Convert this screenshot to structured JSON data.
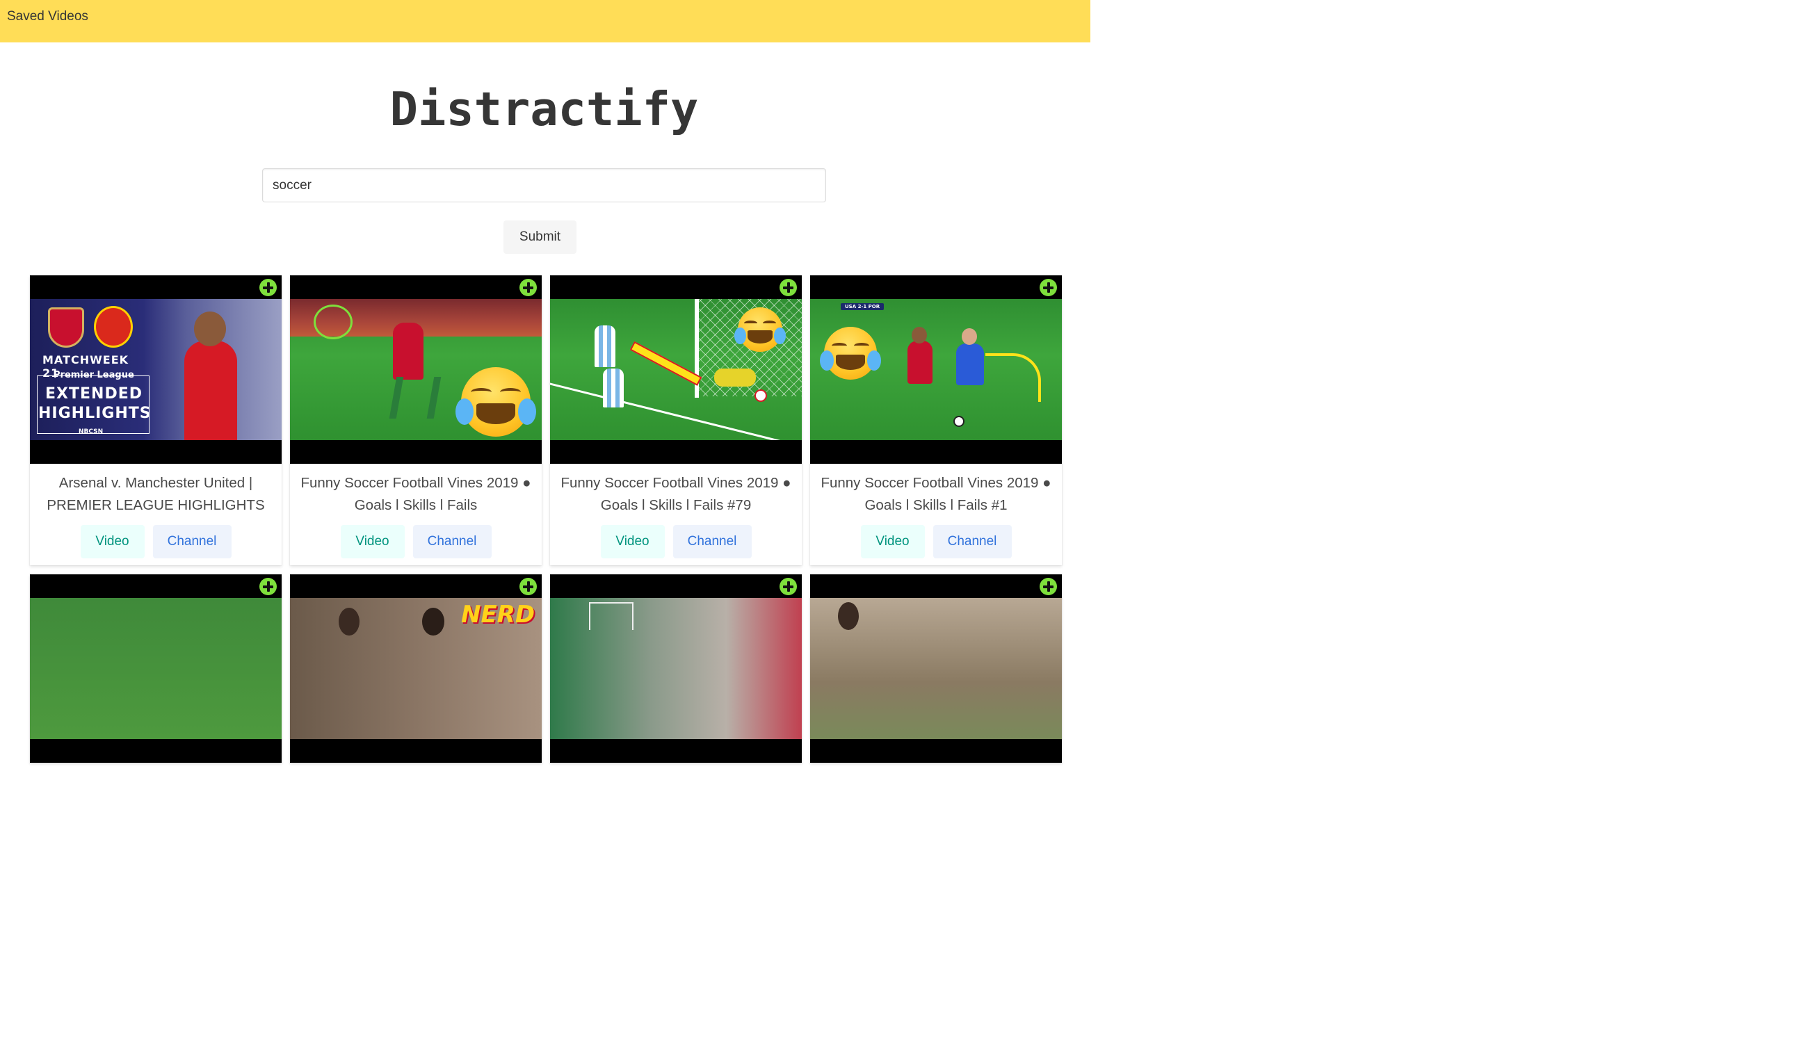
{
  "navbar": {
    "saved_label": "Saved Videos"
  },
  "app": {
    "title": "Distractify"
  },
  "search": {
    "value": "soccer",
    "submit_label": "Submit"
  },
  "colors": {
    "navbar": "#ffdd57",
    "add_icon": "#7ee03c",
    "video_button_text": "#00947e",
    "channel_button_text": "#3273dc"
  },
  "videos": [
    {
      "title": "Arsenal v. Manchester United | PREMIER LEAGUE HIGHLIGHTS",
      "video_label": "Video",
      "channel_label": "Channel",
      "thumb_text": {
        "matchweek": "MATCHWEEK 21",
        "league": "Premier League",
        "extended": "EXTENDED",
        "highlights": "HIGHLIGHTS",
        "network": "NBCSN"
      }
    },
    {
      "title": "Funny Soccer Football Vines 2019 ● Goals l Skills l Fails",
      "video_label": "Video",
      "channel_label": "Channel"
    },
    {
      "title": "Funny Soccer Football Vines 2019 ● Goals l Skills l Fails #79",
      "video_label": "Video",
      "channel_label": "Channel"
    },
    {
      "title": "Funny Soccer Football Vines 2019 ● Goals l Skills l Fails #1",
      "video_label": "Video",
      "channel_label": "Channel",
      "thumb_text": {
        "scoreboard": "USA 2-1 POR"
      }
    },
    {
      "title": ""
    },
    {
      "title": "",
      "thumb_text": {
        "banner": "NERD"
      }
    },
    {
      "title": ""
    },
    {
      "title": ""
    }
  ]
}
